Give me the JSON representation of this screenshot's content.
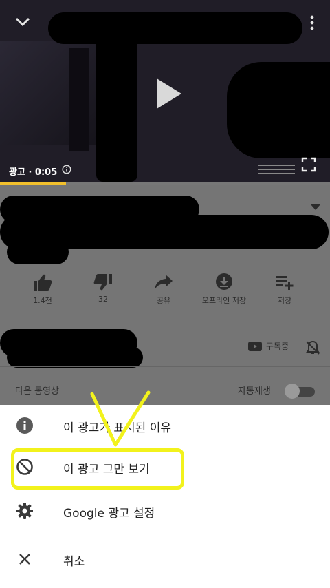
{
  "player": {
    "ad_label": "광고 · 0:05",
    "progress_fraction": 0.2
  },
  "actions": [
    {
      "label": "1.4천",
      "icon": "thumbs-up-icon"
    },
    {
      "label": "32",
      "icon": "thumbs-down-icon"
    },
    {
      "label": "공유",
      "icon": "share-icon"
    },
    {
      "label": "오프라인 저장",
      "icon": "download-icon"
    },
    {
      "label": "저장",
      "icon": "add-to-playlist-icon"
    }
  ],
  "channel": {
    "subscribed_label": "구독중"
  },
  "up_next": {
    "label": "다음 동영상",
    "autoplay_label": "자동재생",
    "autoplay_on": false
  },
  "menu": {
    "items": [
      {
        "label": "이 광고가 표시된 이유",
        "icon": "info-icon"
      },
      {
        "label": "이 광고 그만 보기",
        "icon": "block-icon"
      },
      {
        "label": "Google 광고 설정",
        "icon": "gear-icon"
      }
    ],
    "cancel_label": "취소"
  },
  "colors": {
    "progress": "#f2c02c",
    "highlight": "#f2f21c"
  }
}
